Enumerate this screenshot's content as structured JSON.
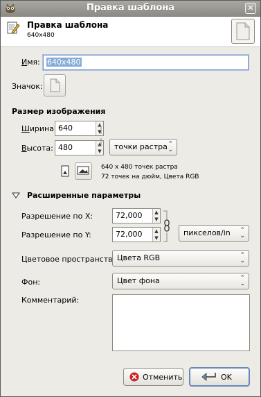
{
  "window": {
    "title": "Правка шаблона",
    "close_symbol": "✕"
  },
  "header": {
    "title": "Правка шаблона",
    "subtitle": "640x480"
  },
  "name_field": {
    "label": "Имя:",
    "value": "640x480"
  },
  "icon_field": {
    "label": "Значок:"
  },
  "image_size": {
    "section_title": "Размер изображения",
    "width_label": "Ширина:",
    "width_value": "640",
    "height_label": "Высота:",
    "height_value": "480",
    "units": "точки растра",
    "info_line1": "640 x 480 точек растра",
    "info_line2": "72 точек на дюйм, Цвета RGB"
  },
  "advanced": {
    "section_title": "Расширенные параметры",
    "xres_label": "Разрешение по X:",
    "xres_value": "72,000",
    "yres_label": "Разрешение по Y:",
    "yres_value": "72,000",
    "res_units": "пикселов/in",
    "colorspace_label": "Цветовое пространство:",
    "colorspace_value": "Цвета RGB",
    "fill_label": "Фон:",
    "fill_value": "Цвет фона",
    "comment_label": "Комментарий:",
    "comment_value": ""
  },
  "buttons": {
    "cancel": "Отменить",
    "ok": "OK"
  },
  "colors": {
    "titlebar": "#9a9993",
    "dialog_bg": "#edebe6",
    "selection": "#86abd9",
    "focus_border": "#7a96c4",
    "cancel_icon": "#cc2222"
  }
}
